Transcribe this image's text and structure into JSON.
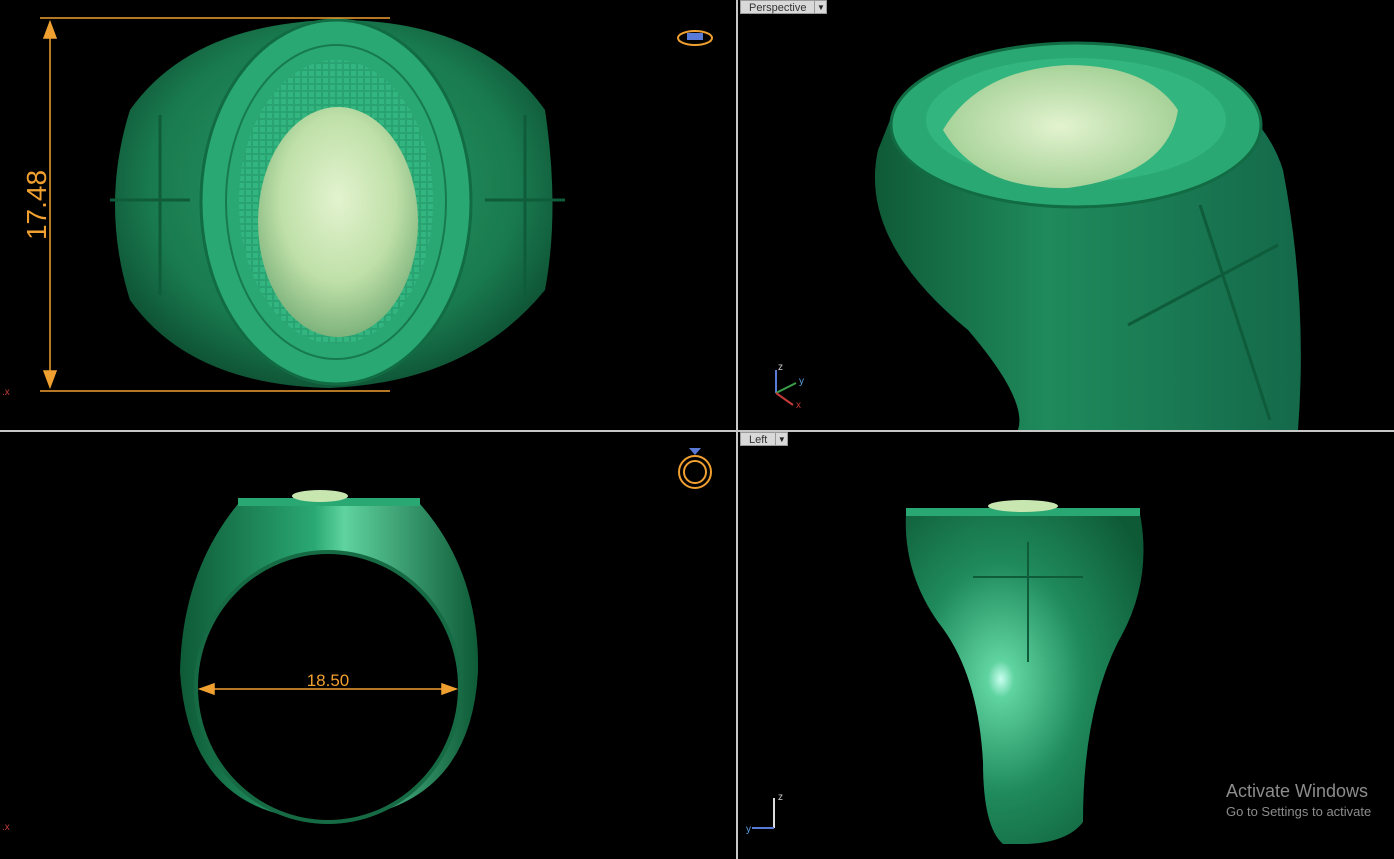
{
  "viewports": {
    "top_left": {
      "label": "",
      "dimension": "17.48",
      "axis": ".x"
    },
    "top_right": {
      "label": "Perspective",
      "axis": {
        "z": "z",
        "y": "y",
        "x": "x"
      }
    },
    "bottom_left": {
      "label": "",
      "dimension": "18.50",
      "axis": ".x"
    },
    "bottom_right": {
      "label": "Left",
      "axis": {
        "z": "z",
        "y": "y"
      }
    }
  },
  "icons": {
    "top_left": "ring-top-view-icon",
    "bottom_left": "ring-front-view-icon"
  },
  "watermark": {
    "title": "Activate Windows",
    "subtitle": "Go to Settings to activate"
  },
  "colors": {
    "ring": "#1f8a5c",
    "bezel": "#2aa873",
    "portrait": "#c8e6b0",
    "dimension": "#f0a030",
    "divider": "#c8c8c8"
  }
}
